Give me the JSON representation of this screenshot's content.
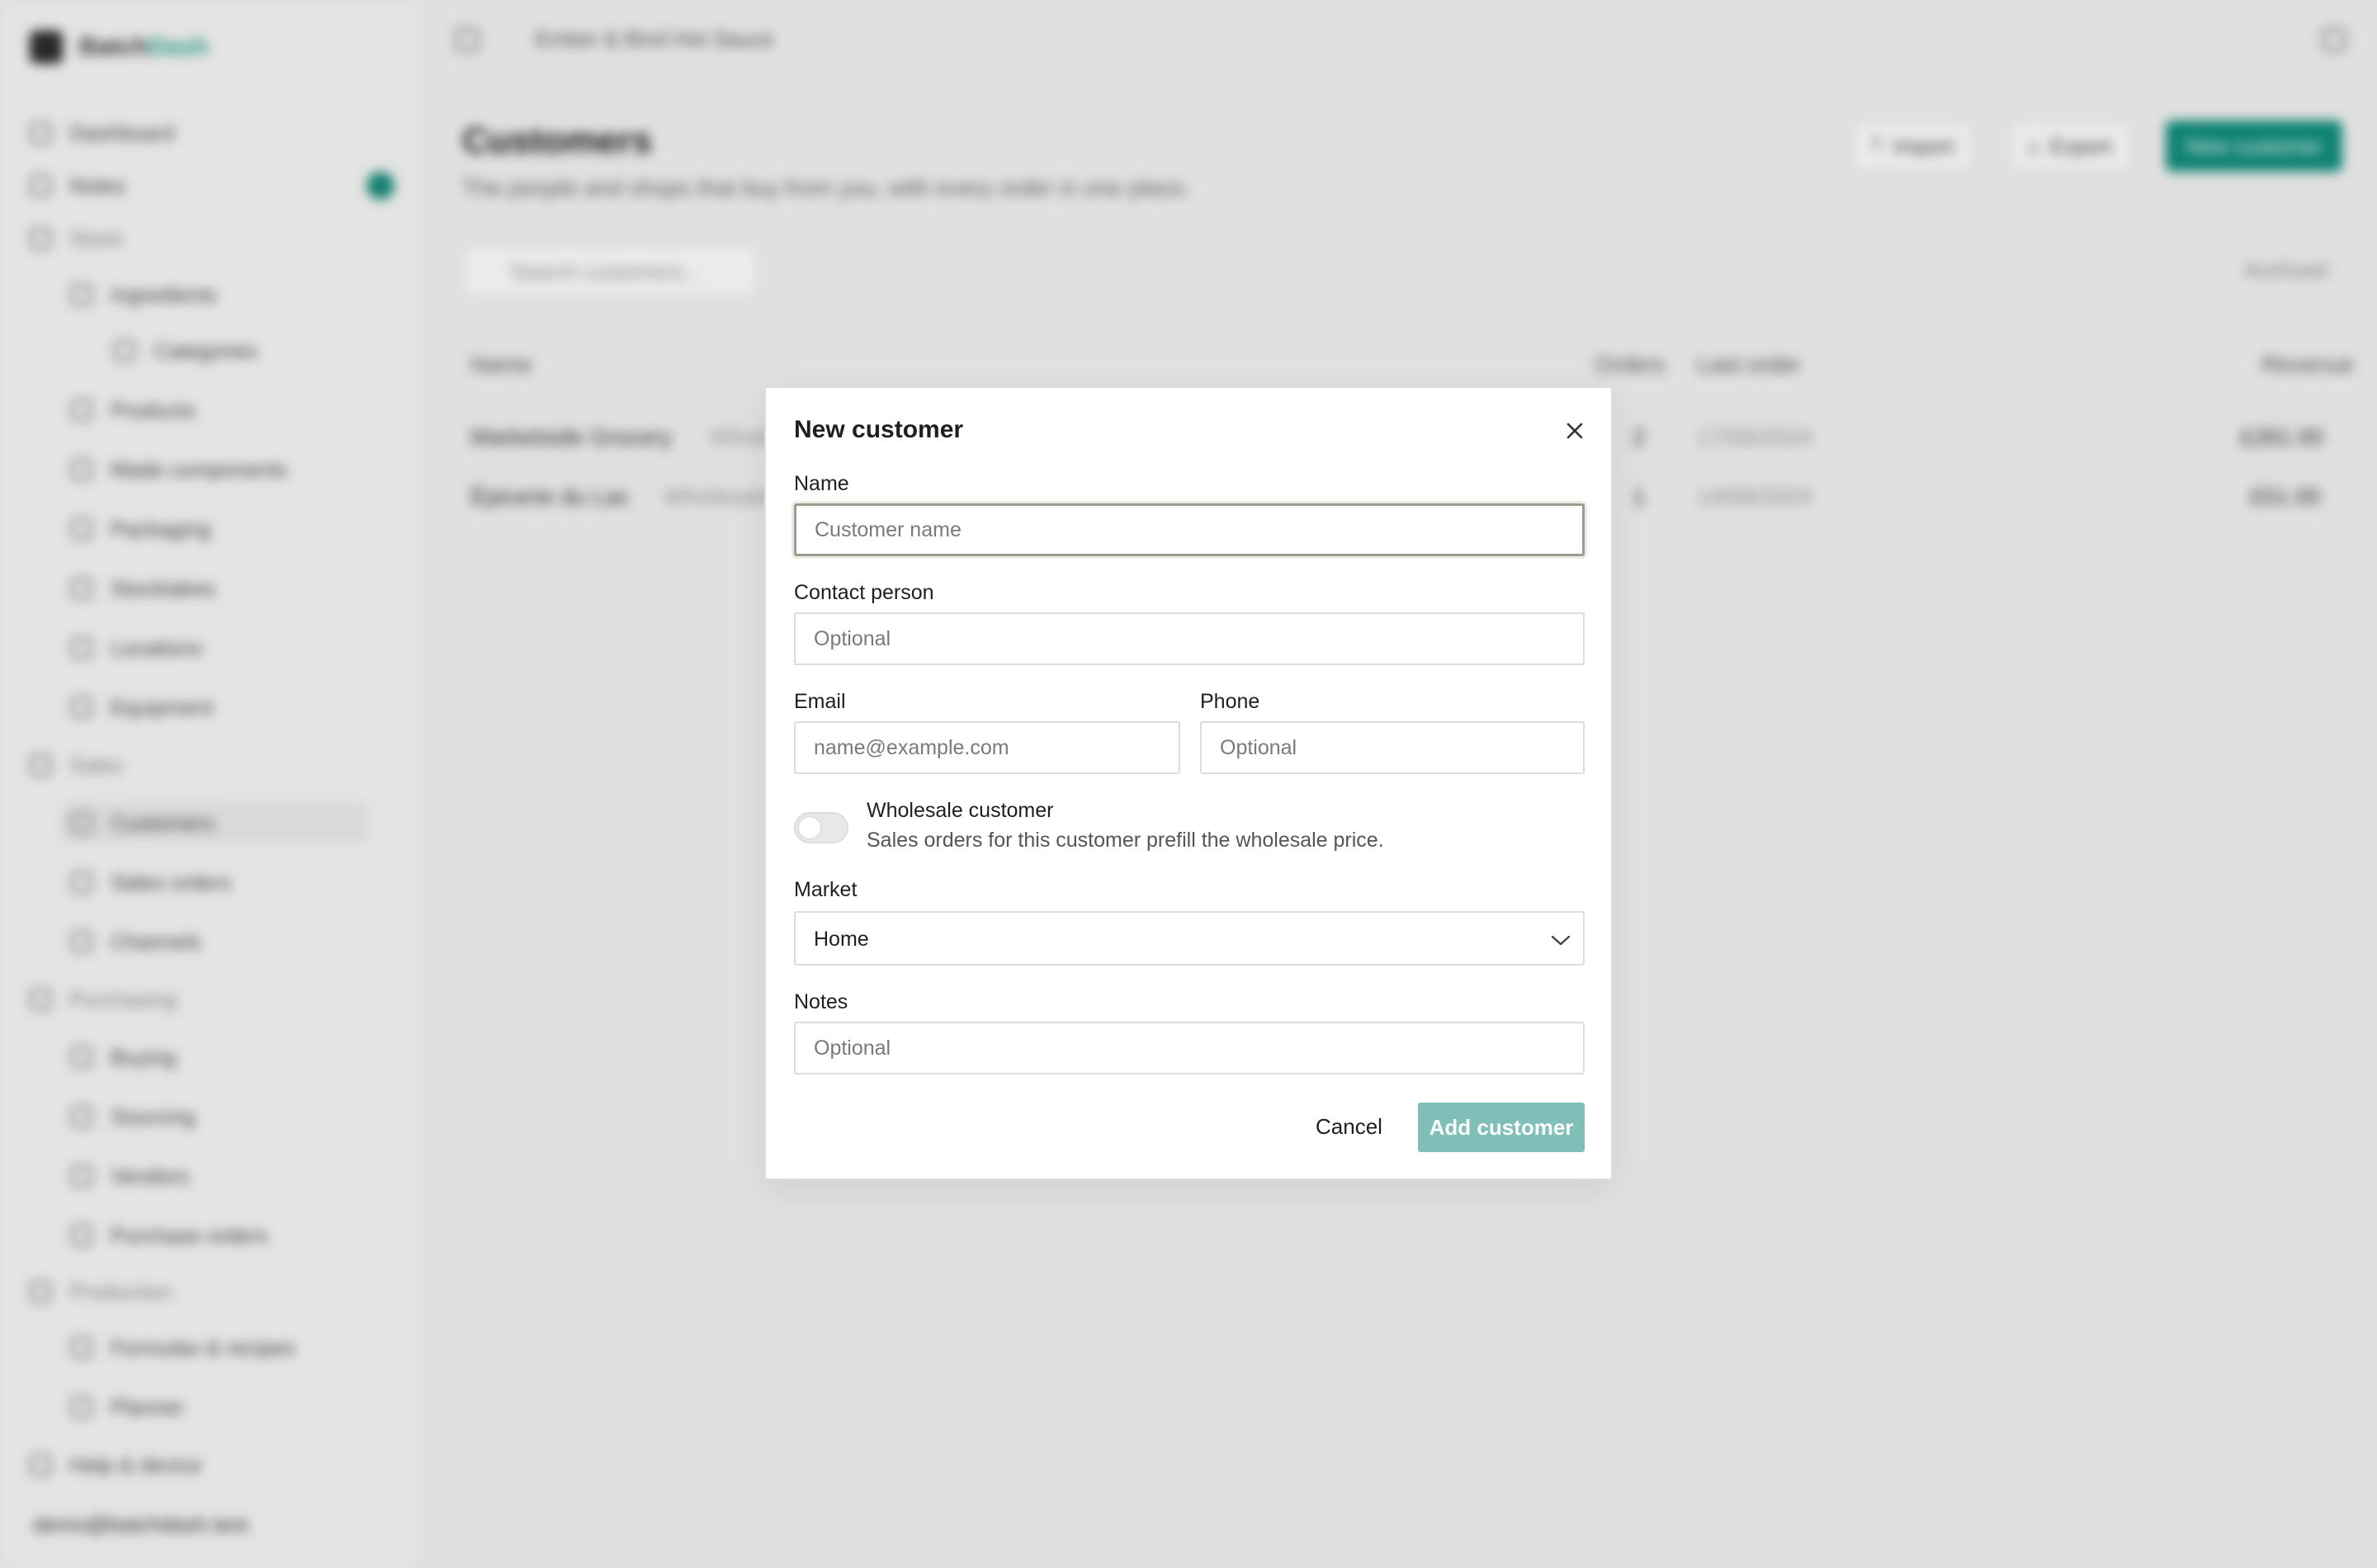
{
  "app": {
    "brand_prefix": "Batch",
    "brand_suffix": "Dash",
    "workspace_title": "Ember & Bind Hot Sauce",
    "accent_color": "#0f8e7d"
  },
  "sidebar": {
    "items": [
      {
        "label": "Dashboard"
      },
      {
        "label": "Notes"
      },
      {
        "label": "Stock"
      },
      {
        "label": "Ingredients"
      },
      {
        "label": "Categories"
      },
      {
        "label": "Products"
      },
      {
        "label": "Made components"
      },
      {
        "label": "Packaging"
      },
      {
        "label": "Stocktakes"
      },
      {
        "label": "Locations"
      },
      {
        "label": "Equipment"
      },
      {
        "label": "Sales"
      },
      {
        "label": "Customers"
      },
      {
        "label": "Sales orders"
      },
      {
        "label": "Channels"
      },
      {
        "label": "Purchasing"
      },
      {
        "label": "Buying"
      },
      {
        "label": "Sourcing"
      },
      {
        "label": "Vendors"
      },
      {
        "label": "Purchase orders"
      },
      {
        "label": "Production"
      },
      {
        "label": "Formulas & recipes"
      },
      {
        "label": "Planner"
      },
      {
        "label": "Help & device"
      }
    ],
    "user_email": "demo@batchdash.test"
  },
  "page": {
    "title": "Customers",
    "subtitle": "The people and shops that buy from you, with every order in one place.",
    "import_label": "Import",
    "export_label": "Export",
    "new_label": "New customer",
    "search_placeholder": "Search customers...",
    "archived_label": "Archived"
  },
  "table": {
    "headers": {
      "name": "Name",
      "orders": "Orders",
      "last_order": "Last order",
      "revenue": "Revenue"
    },
    "rows": [
      {
        "name": "Marketside Grocery",
        "type": "Wholesale",
        "orders": "2",
        "last_order": "17/06/2024",
        "revenue": "£281.00"
      },
      {
        "name": "Épicerie du Lac",
        "type": "Wholesale",
        "orders": "1",
        "last_order": "14/06/2024",
        "revenue": "£51.00"
      }
    ]
  },
  "modal": {
    "title": "New customer",
    "name_label": "Name",
    "name_placeholder": "Customer name",
    "contact_label": "Contact person",
    "contact_placeholder": "Optional",
    "email_label": "Email",
    "email_placeholder": "name@example.com",
    "phone_label": "Phone",
    "phone_placeholder": "Optional",
    "wholesale_label": "Wholesale customer",
    "wholesale_desc": "Sales orders for this customer prefill the wholesale price.",
    "market_label": "Market",
    "market_value": "Home",
    "notes_label": "Notes",
    "notes_placeholder": "Optional",
    "cancel_label": "Cancel",
    "submit_label": "Add customer"
  }
}
